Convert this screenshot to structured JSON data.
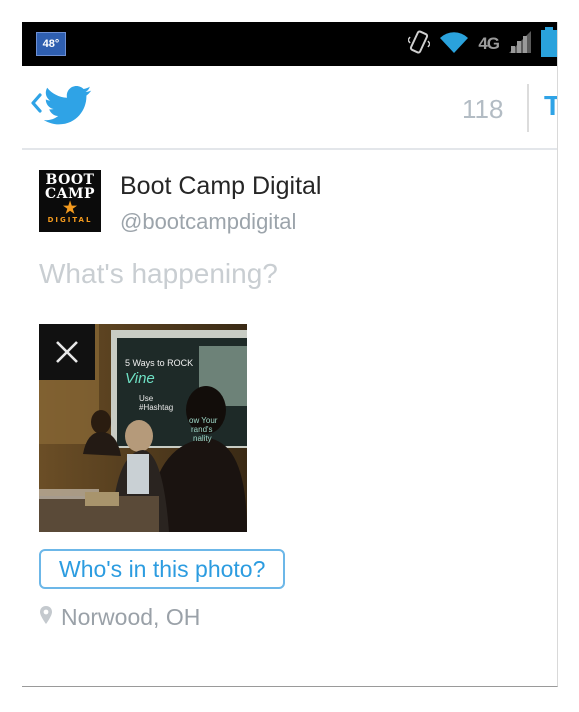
{
  "status_bar": {
    "temperature": "48°",
    "network": "4G"
  },
  "action_bar": {
    "char_count": "118",
    "tweet_partial": "T"
  },
  "compose": {
    "avatar": {
      "line1": "BOOT",
      "line2": "CAMP",
      "line3": "DIGITAL"
    },
    "display_name": "Boot Camp Digital",
    "handle": "@bootcampdigital",
    "placeholder": "What's happening?",
    "photo": {
      "slide_title": "5 Ways to ROCK",
      "slide_brand": "Vine",
      "slide_item1": "Use",
      "slide_item2": "#Hashtag",
      "slide_item3": "ow Your",
      "slide_item4": "rand's",
      "slide_item5": "nality"
    },
    "tag_button": "Who's in this photo?",
    "location": "Norwood, OH"
  },
  "colors": {
    "accent": "#2fa3e6",
    "muted": "#9aa1a8",
    "placeholder": "#c9ced2"
  }
}
